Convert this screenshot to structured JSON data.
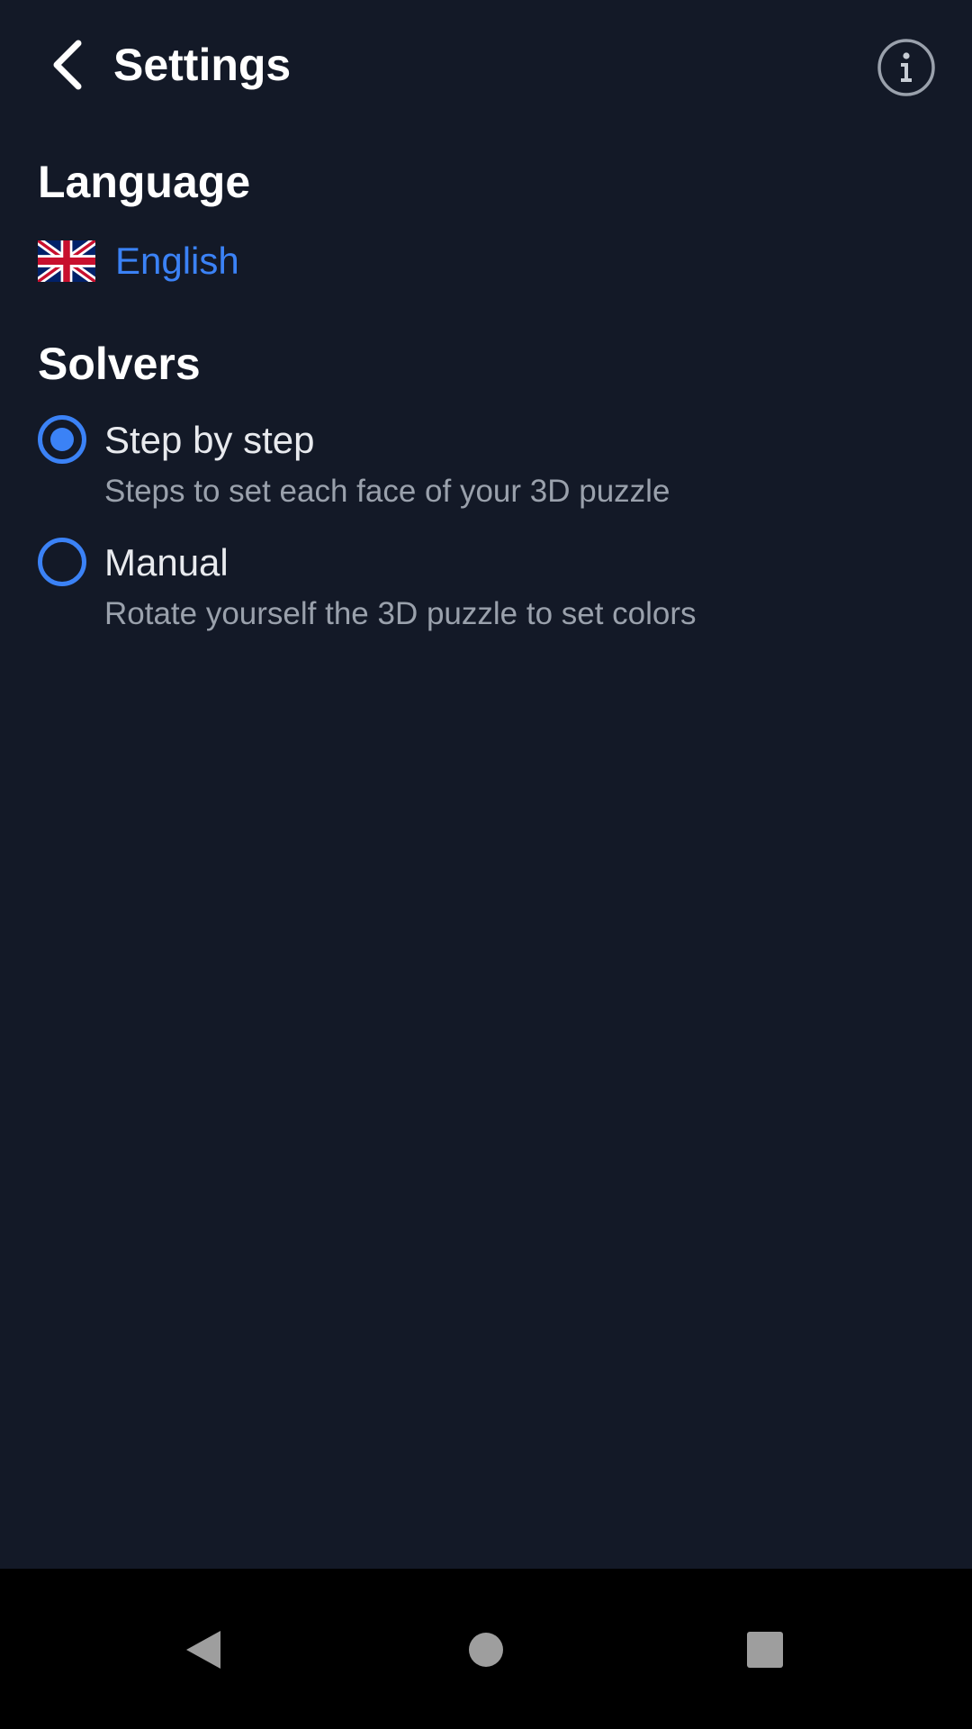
{
  "header": {
    "title": "Settings",
    "back_icon": "chevron-left-icon",
    "info_icon": "info-icon"
  },
  "language": {
    "heading": "Language",
    "flag_icon": "uk-flag-icon",
    "selected": "English"
  },
  "solvers": {
    "heading": "Solvers",
    "options": [
      {
        "label": "Step by step",
        "description": "Steps to set each face of your 3D puzzle",
        "selected": true
      },
      {
        "label": "Manual",
        "description": "Rotate yourself the 3D puzzle to set colors",
        "selected": false
      }
    ]
  },
  "nav": {
    "back_icon": "nav-back-icon",
    "home_icon": "nav-home-icon",
    "recents_icon": "nav-recents-icon"
  },
  "colors": {
    "background": "#131927",
    "accent": "#3b82f6",
    "text_primary": "#ffffff",
    "text_secondary": "#9aa1ac",
    "nav_bar": "#000000"
  }
}
